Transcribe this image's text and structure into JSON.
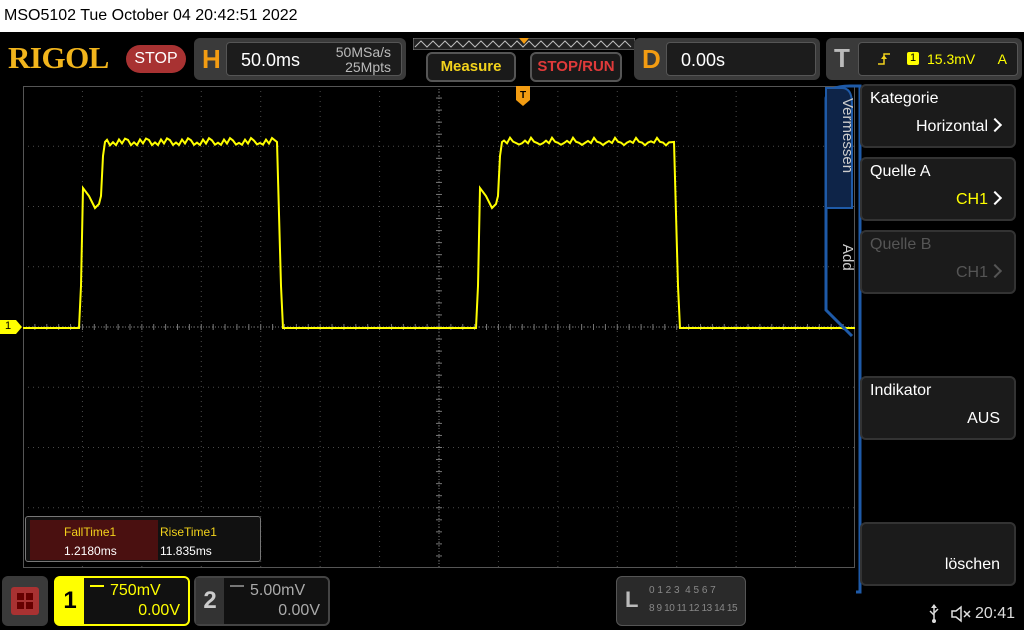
{
  "titlebar": {
    "text": "MSO5102  Tue October 04 20:42:51 2022"
  },
  "logo": {
    "text": "RIGOL"
  },
  "status": {
    "run_state": "STOP"
  },
  "horizontal": {
    "letter": "H",
    "timebase": "50.0ms",
    "sample_rate": "50MSa/s",
    "memory_depth": "25Mpts"
  },
  "buttons": {
    "measure": "Measure",
    "stop_run": "STOP/RUN"
  },
  "delay": {
    "letter": "D",
    "value": "0.00s"
  },
  "trigger": {
    "letter": "T",
    "source": "1",
    "level": "15.3mV",
    "mode": "A"
  },
  "menu": {
    "tabs": [
      "Vermessen",
      "Add"
    ],
    "items": [
      {
        "label": "Kategorie",
        "value": "Horizontal",
        "chevron": true,
        "disabled": false
      },
      {
        "label": "Quelle A",
        "value": "CH1",
        "chevron": true,
        "disabled": false
      },
      {
        "label": "Quelle B",
        "value": "CH1",
        "chevron": true,
        "disabled": true
      },
      {
        "label": "Indikator",
        "value": "AUS",
        "chevron": false,
        "disabled": false
      },
      {
        "label": "",
        "value": "löschen",
        "chevron": false,
        "disabled": false
      }
    ]
  },
  "measurements": {
    "fall_label": "FallTime1",
    "fall_value": "1.2180ms",
    "rise_label": "RiseTime1",
    "rise_value": "11.835ms"
  },
  "channel1": {
    "number": "1",
    "scale": "750mV",
    "offset": "0.00V",
    "marker": "1"
  },
  "channel2": {
    "number": "2",
    "scale": "5.00mV",
    "offset": "0.00V"
  },
  "logic": {
    "letter": "L",
    "row1": "0 1 2 3  4 5 6 7",
    "row2": "8 9 10 11 12 13 14 15"
  },
  "clock": {
    "time": "20:41"
  },
  "colors": {
    "ch1": "#ffff00",
    "accent": "#f39c12",
    "menu_border": "#1e5aa8",
    "stop": "#a83232"
  }
}
